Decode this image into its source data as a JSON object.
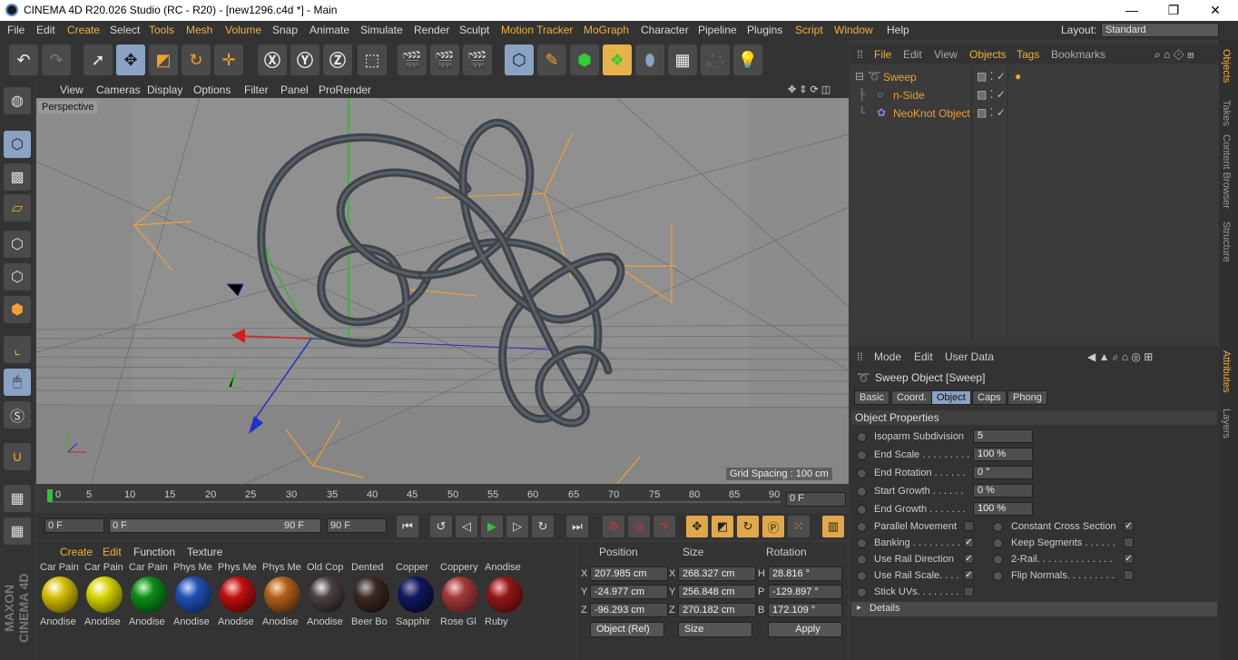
{
  "window": {
    "title": "CINEMA 4D R20.026 Studio (RC - R20) - [new1296.c4d *] - Main",
    "min": "—",
    "restore": "❐",
    "close": "✕"
  },
  "menu": [
    "File",
    "Edit",
    "Create",
    "Select",
    "Tools",
    "Mesh",
    "Volume",
    "Snap",
    "Animate",
    "Simulate",
    "Render",
    "Sculpt",
    "Motion Tracker",
    "MoGraph",
    "Character",
    "Pipeline",
    "Plugins",
    "Script",
    "Window",
    "Help"
  ],
  "layout": {
    "label": "Layout:",
    "value": "Standard"
  },
  "viewport": {
    "menu": [
      "View",
      "Cameras",
      "Display",
      "Options",
      "Filter",
      "Panel",
      "ProRender"
    ],
    "camera": "Perspective",
    "grid_spacing": "Grid Spacing : 100 cm"
  },
  "timeline": {
    "ticks": [
      "0",
      "5",
      "10",
      "15",
      "20",
      "25",
      "30",
      "35",
      "40",
      "45",
      "50",
      "55",
      "60",
      "65",
      "70",
      "75",
      "80",
      "85",
      "90"
    ],
    "current": "0 F",
    "end": "0 F"
  },
  "transport": {
    "start": "0 F",
    "range_start": "0 F",
    "range_end": "90 F",
    "max": "90 F"
  },
  "materials": {
    "menu": [
      "Create",
      "Edit",
      "Function",
      "Texture"
    ],
    "items": [
      {
        "top": "Car Pain",
        "label": "Anodise",
        "color": "#d4c000"
      },
      {
        "top": "Car Pain",
        "label": "Anodise",
        "color": "#d8d400"
      },
      {
        "top": "Car Pain",
        "label": "Anodise",
        "color": "#0d8a1a"
      },
      {
        "top": "Phys Me",
        "label": "Anodise",
        "color": "#2050b0"
      },
      {
        "top": "Phys Me",
        "label": "Anodise",
        "color": "#c01010"
      },
      {
        "top": "Phys Me",
        "label": "Anodise",
        "color": "#b0601c"
      },
      {
        "top": "Old Cop",
        "label": "Anodise",
        "color": "#4a4040"
      },
      {
        "top": "Dented",
        "label": "Beer Bo",
        "color": "#3a2a20"
      },
      {
        "top": "Copper",
        "label": "Sapphir",
        "color": "#101860"
      },
      {
        "top": "Coppery",
        "label": "Rose Gl",
        "color": "#a03838"
      },
      {
        "top": "Anodise",
        "label": "Ruby",
        "color": "#901818"
      }
    ]
  },
  "coords": {
    "headers": [
      "Position",
      "Size",
      "Rotation"
    ],
    "rows": [
      {
        "axis": "X",
        "pos": "207.985 cm",
        "size_axis": "X",
        "size": "268.327 cm",
        "rot_axis": "H",
        "rot": "28.816 °"
      },
      {
        "axis": "Y",
        "pos": "-24.977 cm",
        "size_axis": "Y",
        "size": "256.848 cm",
        "rot_axis": "P",
        "rot": "-129.897 °"
      },
      {
        "axis": "Z",
        "pos": "-96.293 cm",
        "size_axis": "Z",
        "size": "270.182 cm",
        "rot_axis": "B",
        "rot": "172.109 °"
      }
    ],
    "mode": "Object (Rel)",
    "size_mode": "Size",
    "apply": "Apply"
  },
  "objects": {
    "menu": [
      "File",
      "Edit",
      "View",
      "Objects",
      "Tags",
      "Bookmarks"
    ],
    "items": [
      "Sweep",
      "n-Side",
      "NeoKnot Object"
    ]
  },
  "attributes": {
    "menu": [
      "Mode",
      "Edit",
      "User Data"
    ],
    "title": "Sweep Object [Sweep]",
    "tabs": [
      "Basic",
      "Coord.",
      "Object",
      "Caps",
      "Phong"
    ],
    "section": "Object Properties",
    "props": [
      {
        "label": "Isoparm Subdivision",
        "value": "5"
      },
      {
        "label": "End Scale . . . . . . . . .",
        "value": "100 %"
      },
      {
        "label": "End Rotation . . . . . .",
        "value": "0 °"
      },
      {
        "label": "Start Growth . . . . . .",
        "value": "0 %"
      },
      {
        "label": "End Growth . . . . . . .",
        "value": "100 %"
      }
    ],
    "checks_left": [
      {
        "label": "Parallel Movement",
        "checked": ""
      },
      {
        "label": "Banking . . . . . . . . .",
        "checked": "✓"
      },
      {
        "label": "Use Rail Direction",
        "checked": "✓"
      },
      {
        "label": "Use Rail Scale. . . .",
        "checked": "✓"
      },
      {
        "label": "Stick UVs. . . . . . . .",
        "checked": ""
      }
    ],
    "checks_right": [
      {
        "label": "Constant Cross Section",
        "checked": "✓"
      },
      {
        "label": "Keep Segments . . . . . .",
        "checked": ""
      },
      {
        "label": "2-Rail. . . . . . . . . . . . . .",
        "checked": "✓"
      },
      {
        "label": "Flip Normals. . . . . . . . .",
        "checked": ""
      }
    ],
    "details": "Details"
  },
  "right_tabs": [
    "Objects",
    "Takes",
    "Content Browser",
    "Structure",
    "Attributes",
    "Layers"
  ],
  "branding": "MAXON CINEMA 4D"
}
